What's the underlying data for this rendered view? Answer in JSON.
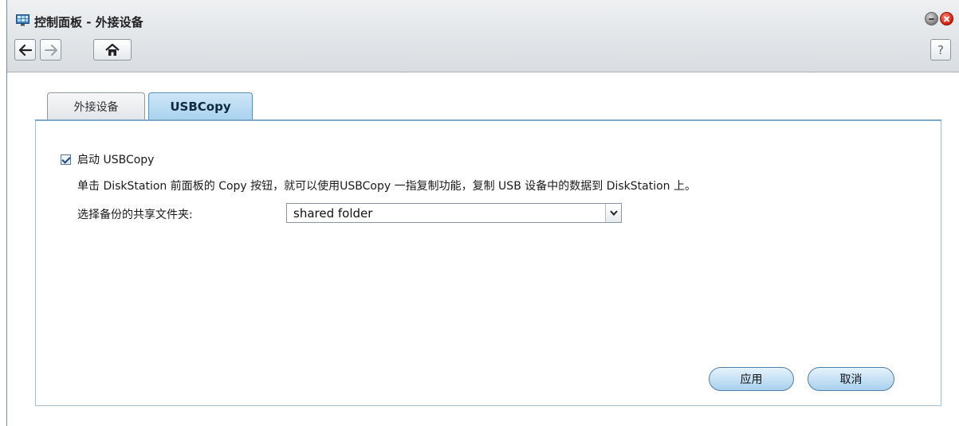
{
  "window": {
    "title": "控制面板 - 外接设备",
    "icons": {
      "app": "control-panel-icon",
      "minimize": "minimize-icon",
      "close": "close-icon"
    }
  },
  "toolbar": {
    "back_icon": "arrow-left-icon",
    "forward_icon": "arrow-right-icon",
    "home_icon": "home-icon",
    "help_label": "?"
  },
  "tabs": [
    {
      "label": "外接设备",
      "active": false
    },
    {
      "label": "USBCopy",
      "active": true
    }
  ],
  "usbcopy": {
    "enable_label": "启动 USBCopy",
    "enable_checked": true,
    "description": "单击 DiskStation 前面板的 Copy 按钮，就可以使用USBCopy 一指复制功能，复制 USB 设备中的数据到 DiskStation 上。",
    "folder_label": "选择备份的共享文件夹:",
    "folder_value": "shared folder"
  },
  "actions": {
    "apply_label": "应用",
    "cancel_label": "取消"
  },
  "colors": {
    "accent": "#7fa9cb",
    "active_tab": "#a8d2ee",
    "close_button": "#d11a0c"
  }
}
